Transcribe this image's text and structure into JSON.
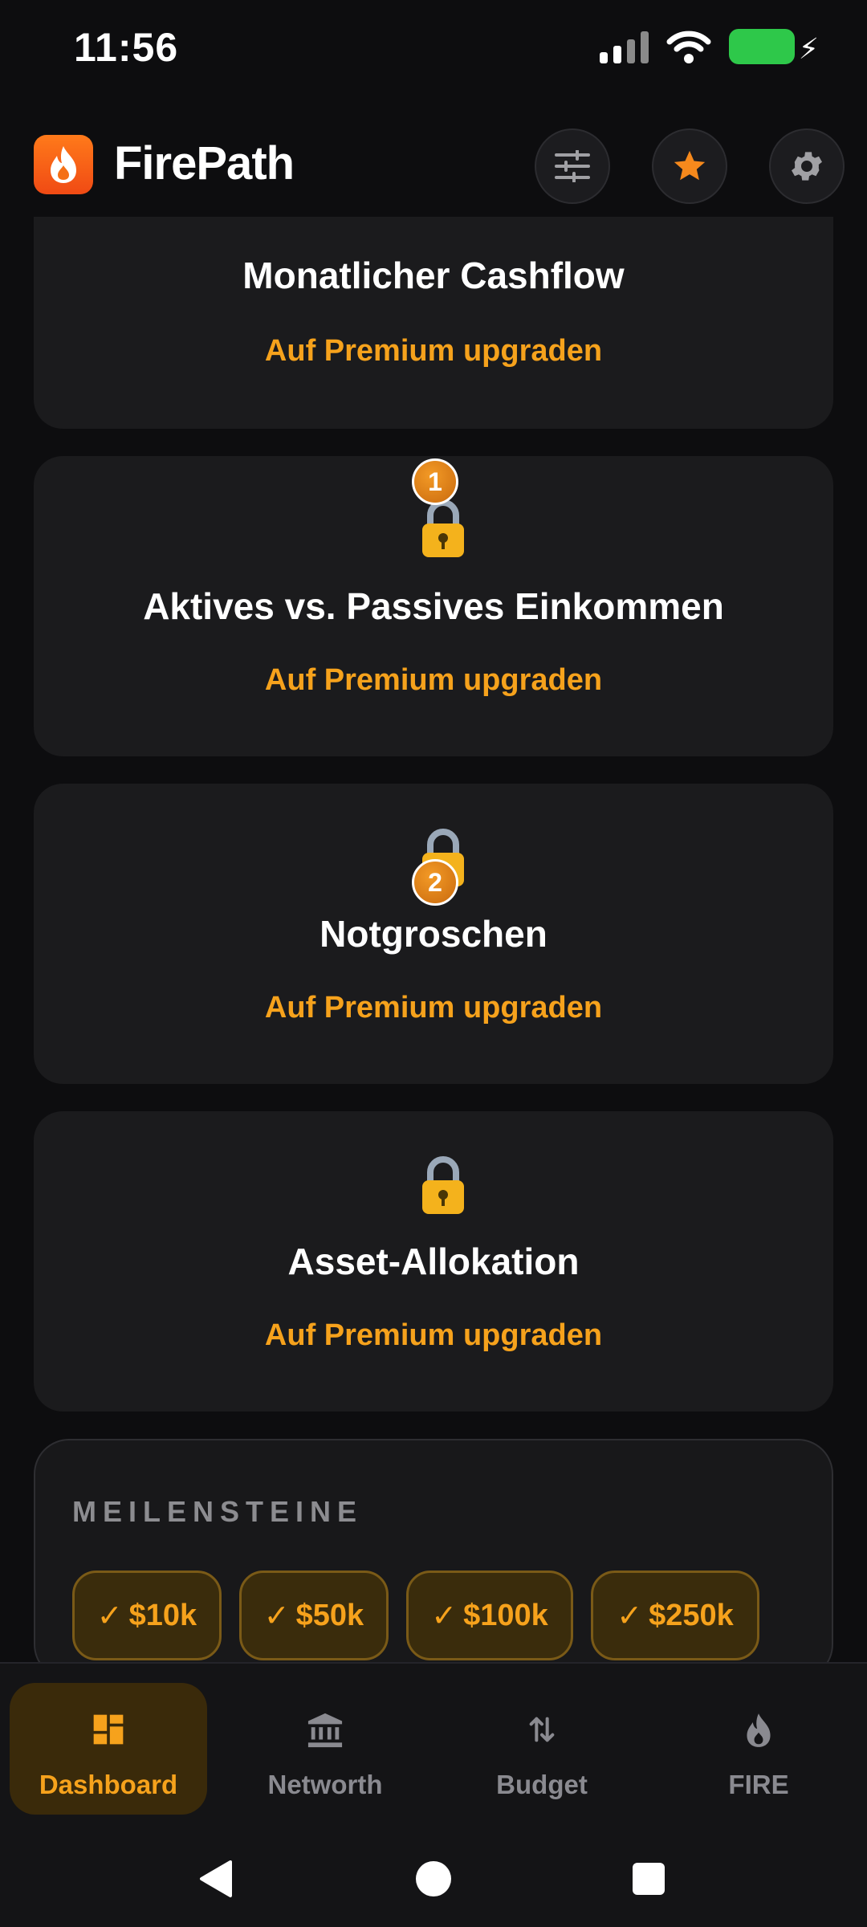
{
  "status_bar": {
    "time": "11:56"
  },
  "app": {
    "title": "FirePath"
  },
  "header_buttons": [
    {
      "name": "filter-sliders-icon"
    },
    {
      "name": "star-icon"
    },
    {
      "name": "gear-icon"
    }
  ],
  "cards": [
    {
      "title": "Monatlicher Cashflow",
      "link": "Auf Premium upgraden"
    },
    {
      "title": "Aktives vs. Passives Einkommen",
      "link": "Auf Premium upgraden",
      "badge": "1"
    },
    {
      "title": "Notgroschen",
      "link": "Auf Premium upgraden",
      "badge": "2"
    },
    {
      "title": "Asset-Allokation",
      "link": "Auf Premium upgraden"
    }
  ],
  "milestones": {
    "title": "MEILENSTEINE",
    "chips": [
      "$10k",
      "$50k",
      "$100k",
      "$250k"
    ],
    "check": "✓"
  },
  "bottom_nav": [
    {
      "label": "Dashboard",
      "icon": "dashboard-icon",
      "active": true
    },
    {
      "label": "Networth",
      "icon": "bank-icon",
      "active": false
    },
    {
      "label": "Budget",
      "icon": "transfer-arrows-icon",
      "active": false
    },
    {
      "label": "FIRE",
      "icon": "flame-icon",
      "active": false
    }
  ],
  "colors": {
    "accent": "#f6a21c",
    "background": "#0d0d0f",
    "card": "#1b1b1d",
    "battery": "#2ec84a"
  }
}
